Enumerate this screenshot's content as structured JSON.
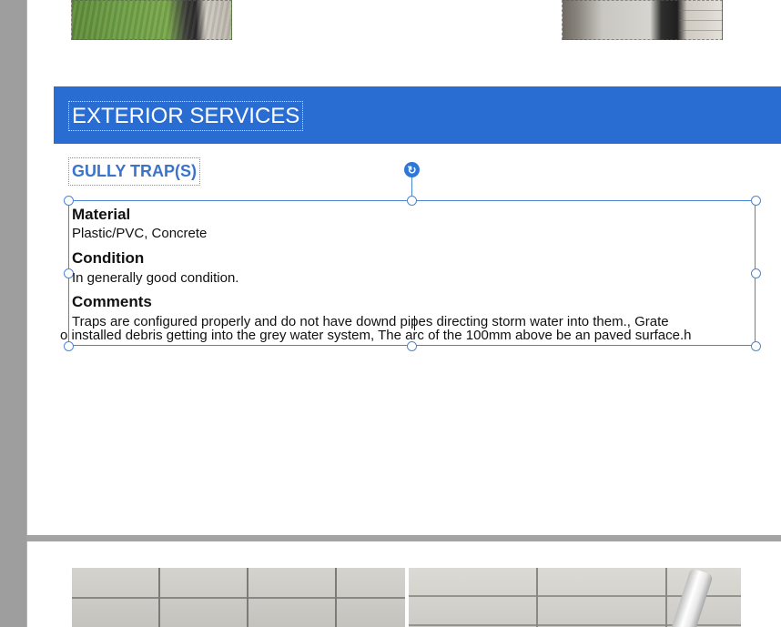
{
  "section": {
    "title": "EXTERIOR SERVICES"
  },
  "subsection": {
    "title": "GULLY TRAP(S)"
  },
  "fields": [
    {
      "label": "Material",
      "value": "Plastic/PVC, Concrete"
    },
    {
      "label": "Condition",
      "value": "In generally good condition."
    },
    {
      "label": "Comments",
      "value": "Traps are configured properly and do not have downd pipes directing storm water into them., Grate"
    }
  ],
  "overflow_text": "o installed debris getting into the grey water system, The arc of the 100mm above be an paved surface.h",
  "colors": {
    "section_bar": "#2a6dd2",
    "subhead_text": "#3a73c9",
    "selection": "#4a86d4"
  },
  "icons": {
    "rotate_handle": "rotate-icon"
  }
}
